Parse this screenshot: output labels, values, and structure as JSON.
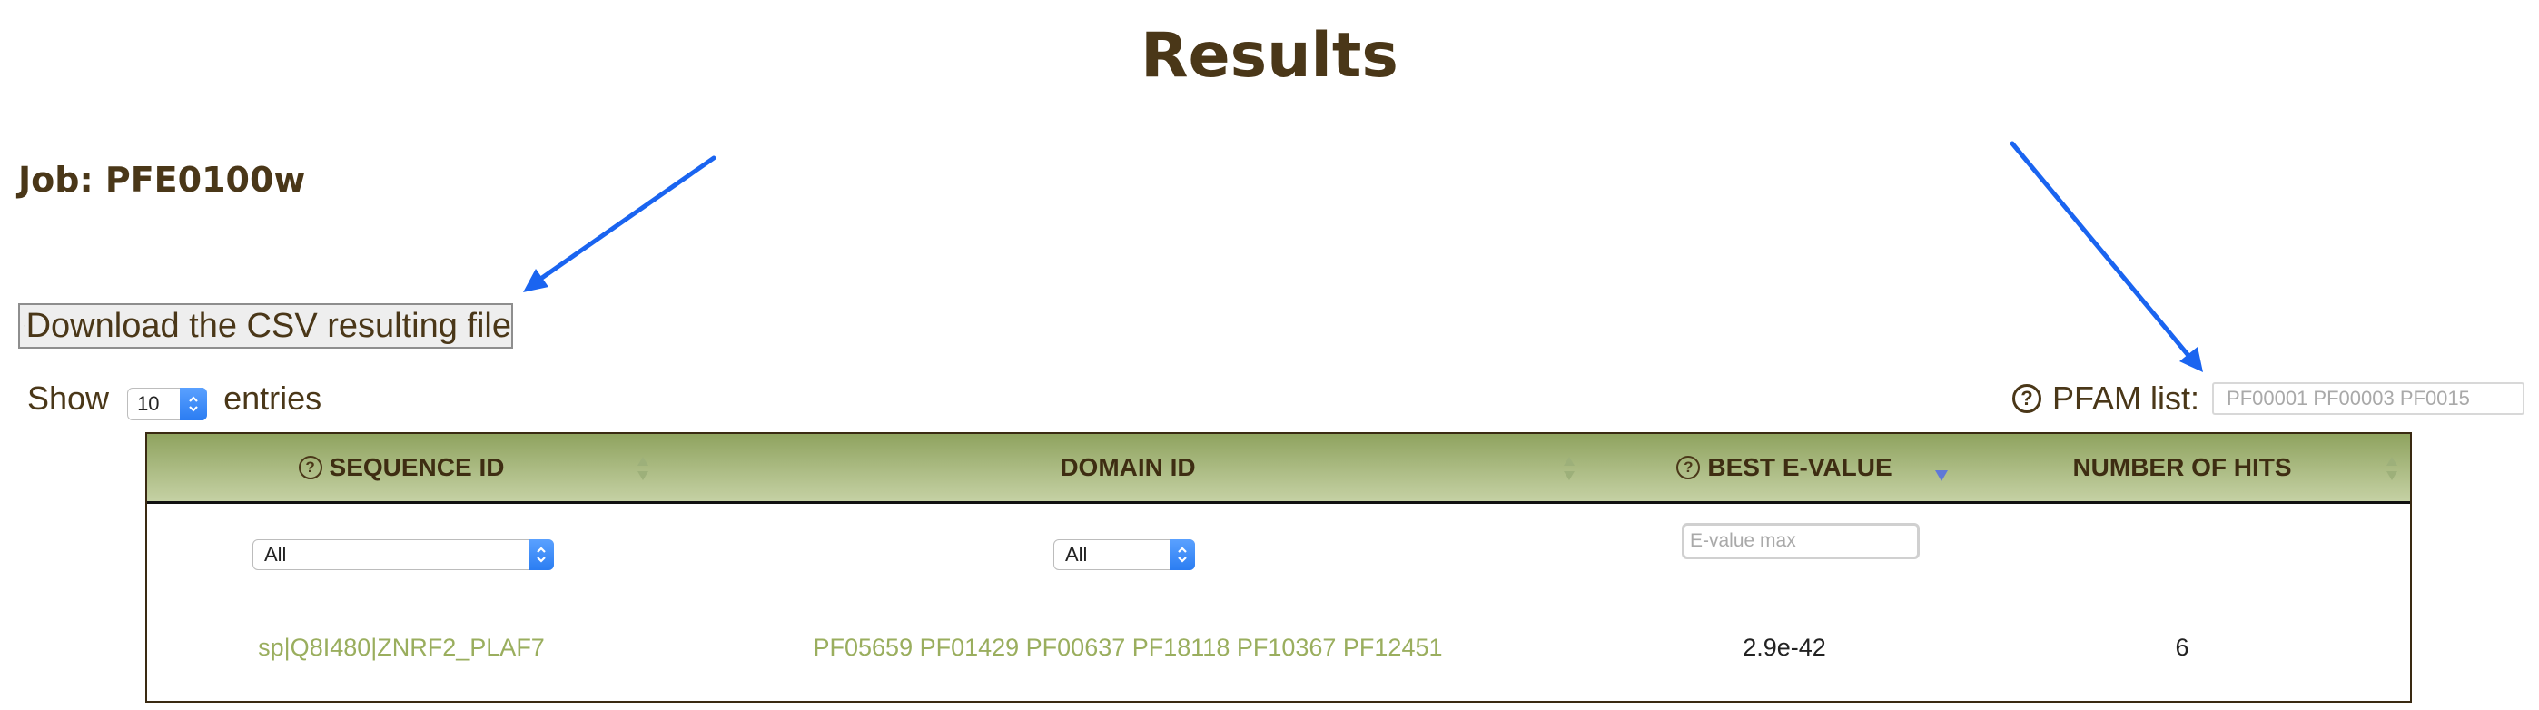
{
  "page": {
    "title": "Results",
    "job_label": "Job: PFE0100w",
    "download_label": "Download the CSV resulting file",
    "show_prefix": "Show",
    "show_value": "10",
    "show_suffix": "entries",
    "pfam_label": "PFAM list:",
    "pfam_placeholder": "PF00001 PF00003 PF0015"
  },
  "table": {
    "columns": [
      {
        "label": "SEQUENCE ID",
        "help": true
      },
      {
        "label": "DOMAIN ID",
        "help": false
      },
      {
        "label": "BEST E-VALUE",
        "help": true,
        "sorted": "desc"
      },
      {
        "label": "NUMBER OF HITS",
        "help": false
      }
    ],
    "filters": {
      "sequence_select": "All",
      "domain_select": "All",
      "evalue_placeholder": "E-value max"
    },
    "rows": [
      {
        "sequence_id": "sp|Q8I480|ZNRF2_PLAF7",
        "domain_id": "PF05659 PF01429 PF00637 PF18118 PF10367 PF12451",
        "best_evalue": "2.9e-42",
        "number_of_hits": "6"
      }
    ]
  },
  "colors": {
    "text_brown": "#4a3718",
    "header_green": "#8fa35f",
    "link_green": "#9aae5e",
    "arrow_blue": "#1a64f0"
  },
  "icons": [
    "download-icon",
    "help-circle-icon",
    "sort-icon",
    "select-stepper-icon"
  ]
}
